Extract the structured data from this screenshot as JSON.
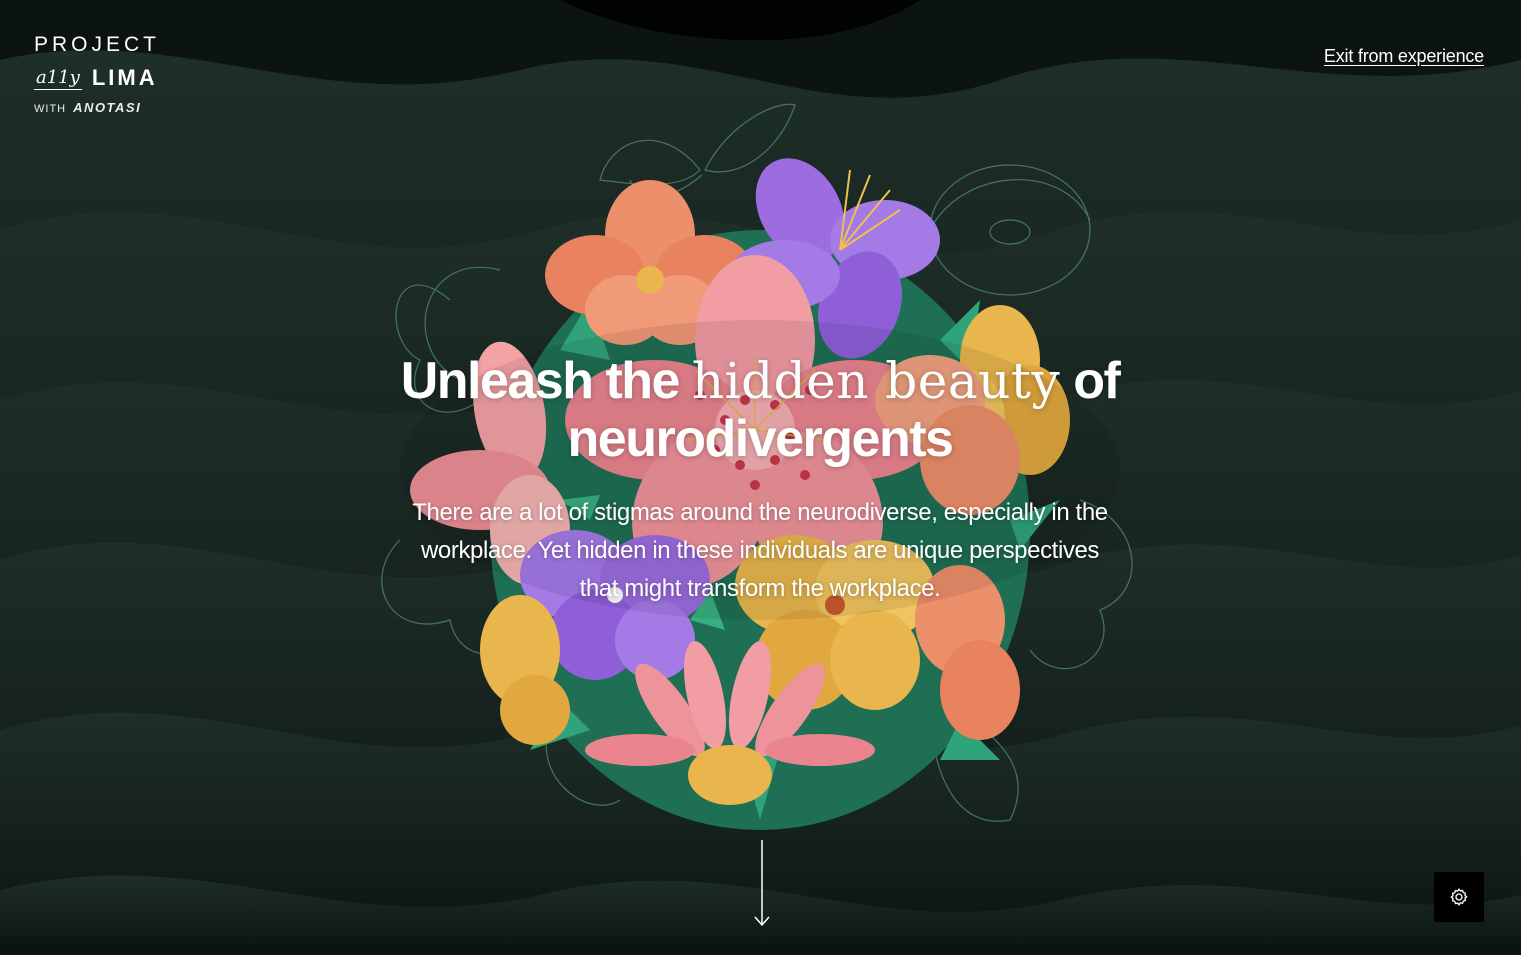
{
  "logo": {
    "line1": "PROJECT",
    "ally": "a11y",
    "lima": "LIMA",
    "with": "WITH",
    "partner": "ANOTASI"
  },
  "nav": {
    "exit_label": "Exit from experience"
  },
  "hero": {
    "headline_part1": "Unleash the",
    "headline_emphasis": "hidden beauty",
    "headline_part2": "of",
    "headline_line2": "neurodivergents",
    "description": "There are a lot of stigmas around the neurodiverse, especially in the workplace. Yet hidden in these individuals are unique perspectives that might transform the workplace."
  },
  "icons": {
    "scroll": "arrow-down-icon",
    "settings": "gear-icon"
  },
  "colors": {
    "background": "#0d1613",
    "wave_dark": "#0a100e",
    "wave_light": "#1d2d27",
    "text": "#ffffff",
    "flower_pink": "#e98b94",
    "flower_coral": "#ec8f6b",
    "flower_purple": "#9d6de0",
    "flower_yellow": "#e8b64c",
    "leaf_green": "#2fa37a",
    "settings_bg": "#000000"
  }
}
